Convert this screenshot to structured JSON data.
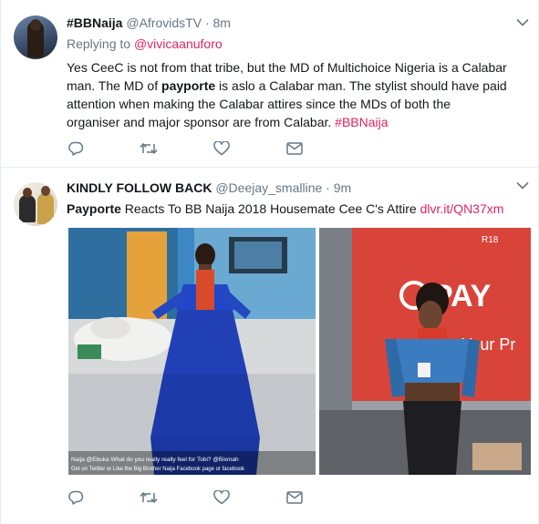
{
  "tweets": [
    {
      "name": "#BBNaija",
      "handle": "@AfrovidsTV",
      "separator": "·",
      "time": "8m",
      "replying_prefix": "Replying to ",
      "replying_to": "@vivicaanuforo",
      "text_part1": "Yes CeeC is not from that tribe, but the MD of Multichoice Nigeria is a Calabar man. The MD of ",
      "text_bold": "payporte",
      "text_part2": " is aslo a Calabar man. The stylist should have paid attention when making the Calabar attires since the MDs of both the organiser and major sponsor are from Calabar. ",
      "hashtag": "#BBNaija"
    },
    {
      "name": "KINDLY FOLLOW BACK",
      "handle": "@Deejay_smalline",
      "separator": "·",
      "time": "9m",
      "text_bold": "Payporte",
      "text_rest": " Reacts To BB Naija 2018 Housemate Cee C's Attire ",
      "link": "dlvr.it/QN37xm",
      "media_left_caption": "Naija @Ebuka What do you really really feel for Tobi? @Bixmah",
      "media_left_caption2": "Get on Twitter or Like the Big Brother Naija Facebook page or facebook",
      "media_right_badge": "R18",
      "media_right_sign": "PAY",
      "media_right_sign2": "Your Pr"
    }
  ],
  "icons": {
    "reply": "reply-icon",
    "retweet": "retweet-icon",
    "like": "heart-icon",
    "dm": "envelope-icon",
    "menu": "chevron-down-icon"
  },
  "colors": {
    "link": "#e0245e",
    "blue_link": "#1b95e0",
    "secondary_text": "#657786",
    "icon": "#657786"
  }
}
